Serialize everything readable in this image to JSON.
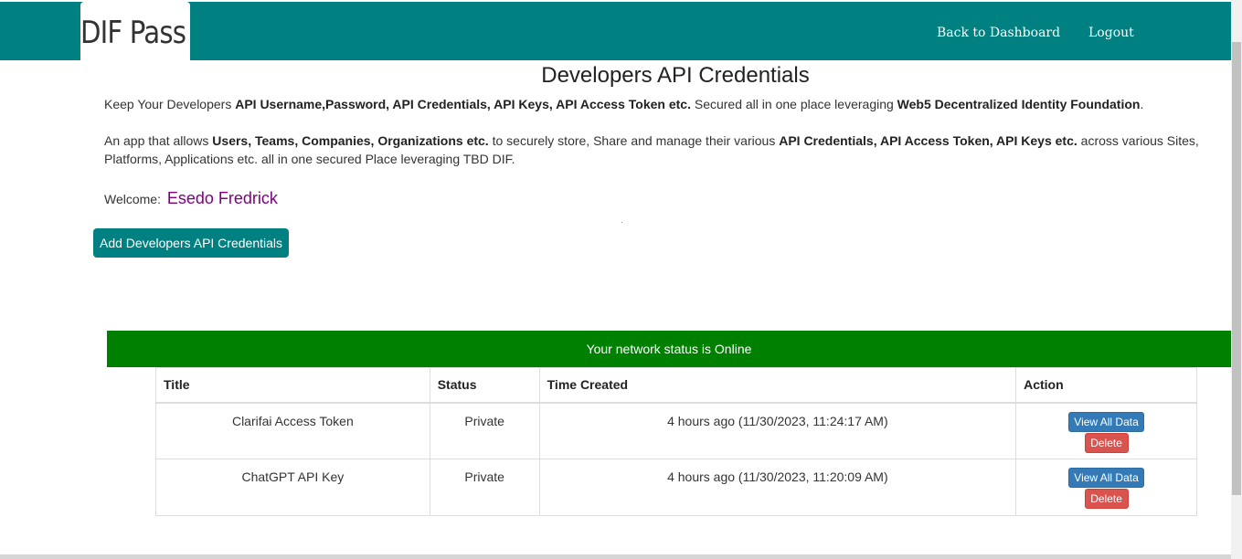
{
  "header": {
    "logo_text": "DIF Pass",
    "nav": [
      "Back to Dashboard",
      "Logout"
    ],
    "color": "#008080"
  },
  "page": {
    "title": "Developers API Credentials",
    "intro": {
      "p1": [
        "Keep Your Developers ",
        "API Username,Password, API Credentials, API Keys, API Access Token etc.",
        " Secured all in one place leveraging ",
        "Web5 Decentralized Identity Foundation",
        "."
      ],
      "p2": [
        "An app that allows ",
        "Users, Teams, Companies, Organizations etc.",
        " to securely store, Share and manage their various ",
        "API Credentials, API Access Token, API Keys etc.",
        " across various Sites, Platforms, Applications etc. all in one secured Place leveraging TBD DIF."
      ]
    },
    "welcome_label": "Welcome:",
    "user_name": "Esedo Fredrick",
    "add_button": "Add Developers API Credentials",
    "network_status": "Your network status is Online"
  },
  "table": {
    "headers": [
      "Title",
      "Status",
      "Time Created",
      "Action"
    ],
    "rows": [
      {
        "title": "Clarifai Access Token",
        "status": "Private",
        "time": "4 hours ago (11/30/2023, 11:24:17 AM)",
        "view": "View All Data",
        "delete": "Delete"
      },
      {
        "title": "ChatGPT API Key",
        "status": "Private",
        "time": "4 hours ago (11/30/2023, 11:20:09 AM)",
        "view": "View All Data",
        "delete": "Delete"
      }
    ]
  },
  "colors": {
    "accent": "#008080",
    "status_online": "#008000",
    "name": "#800080",
    "view_button": "#337ab7",
    "delete_button": "#d9534f"
  }
}
